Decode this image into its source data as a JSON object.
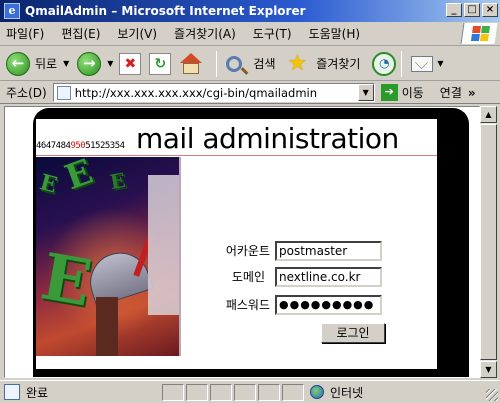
{
  "window": {
    "title": "QmailAdmin – Microsoft Internet Explorer",
    "minimize_glyph": "_",
    "maximize_glyph": "□",
    "close_glyph": "×"
  },
  "menu": {
    "items": [
      "파일(F)",
      "편집(E)",
      "보기(V)",
      "즐겨찾기(A)",
      "도구(T)",
      "도움말(H)"
    ]
  },
  "toolbar": {
    "back_label": "뒤로",
    "search_label": "검색",
    "favorites_label": "즐겨찾기"
  },
  "addressbar": {
    "label": "주소(D)",
    "url": "http://xxx.xxx.xxx.xxx/cgi-bin/qmailadmin",
    "go_label": "이동",
    "links_label": "연결"
  },
  "page": {
    "header_digits_before": "4647484",
    "header_digits_red": "950",
    "header_digits_after": "51525354",
    "header_title": "mail administration",
    "decorative_letters": [
      "E",
      "E",
      "E",
      "E"
    ],
    "form": {
      "account_label": "어카운트",
      "account_value": "postmaster",
      "domain_label": "도메인",
      "domain_value": "nextline.co.kr",
      "password_label": "패스워드",
      "password_value": "●●●●●●●●●",
      "login_button": "로그인"
    }
  },
  "statusbar": {
    "status_text": "완료",
    "zone_text": "인터넷"
  },
  "colors": {
    "titlebar_start": "#0a246a",
    "titlebar_end": "#a6caf0",
    "chrome": "#d4d0c8",
    "header_digit_accent": "#d01010"
  }
}
